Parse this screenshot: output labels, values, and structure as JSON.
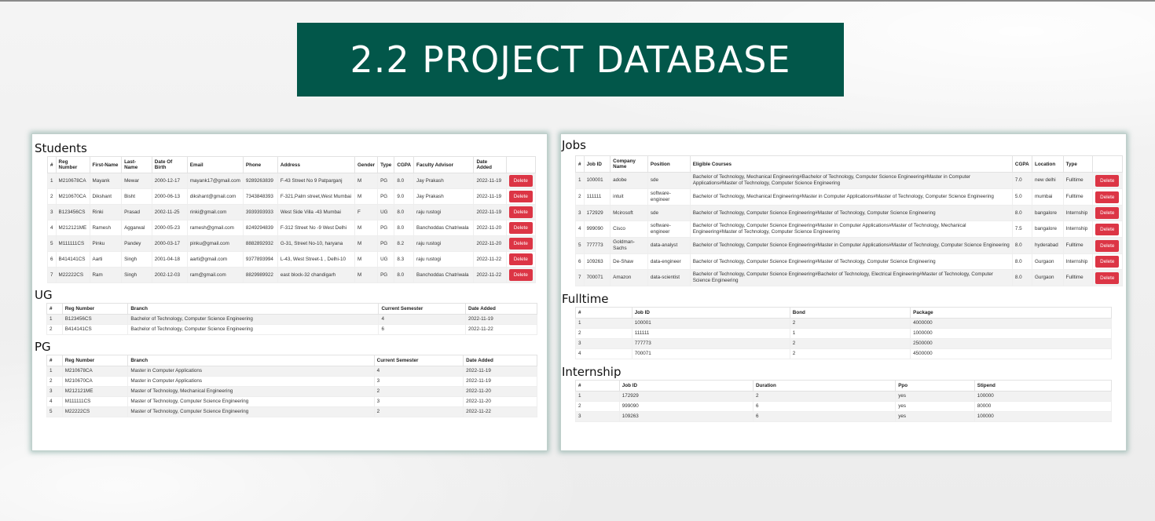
{
  "slide_title": "2.2  PROJECT DATABASE",
  "colors": {
    "title_bg": "#02574a",
    "delete_btn": "#dc3545"
  },
  "delete_label": "Delete",
  "students": {
    "title": "Students",
    "headers": [
      "#",
      "Reg Number",
      "First-Name",
      "Last-Name",
      "Date Of Birth",
      "Email",
      "Phone",
      "Address",
      "Gender",
      "Type",
      "CGPA",
      "Faculty Advisor",
      "Date Added",
      ""
    ],
    "rows": [
      [
        "1",
        "M210678CA",
        "Mayank",
        "Mewar",
        "2000-12-17",
        "mayank17@gmail.com",
        "9289263839",
        "F-43 Street No 9 Patparganj",
        "M",
        "PG",
        "8.0",
        "Jay Prakash",
        "2022-11-19"
      ],
      [
        "2",
        "M210670CA",
        "Dikshant",
        "Bisht",
        "2000-06-13",
        "dikshant@gmail.com",
        "7343848393",
        "F-321,Palm street,West Mumbai",
        "M",
        "PG",
        "9.0",
        "Jay Prakash",
        "2022-11-19"
      ],
      [
        "3",
        "B123456CS",
        "Rinki",
        "Prasad",
        "2002-11-25",
        "rinki@gmail.com",
        "3939393933",
        "West Side Villa -43 Mumbai",
        "F",
        "UG",
        "8.0",
        "raju rustogi",
        "2022-11-19"
      ],
      [
        "4",
        "M212121ME",
        "Ramesh",
        "Aggarwal",
        "2000-05-23",
        "ramesh@gmail.com",
        "8249294839",
        "F-312 Street No -9 West Delhi",
        "M",
        "PG",
        "8.0",
        "Banchoddas Chatriwala",
        "2022-11-20"
      ],
      [
        "5",
        "M111111CS",
        "Pinku",
        "Pandey",
        "2000-03-17",
        "pinku@gmail.com",
        "8882892932",
        "G-31, Street No-10, haryana",
        "M",
        "PG",
        "8.2",
        "raju rustogi",
        "2022-11-20"
      ],
      [
        "6",
        "B414141CS",
        "Aarti",
        "Singh",
        "2001-04-18",
        "aarti@gmail.com",
        "9377893994",
        "L-43, West Street-1 , Delhi-10",
        "M",
        "UG",
        "8.3",
        "raju rustogi",
        "2022-11-22"
      ],
      [
        "7",
        "M22222CS",
        "Ram",
        "Singh",
        "2002-12-03",
        "ram@gmail.com",
        "8829989922",
        "east block-32 chandigarh",
        "M",
        "PG",
        "8.0",
        "Banchoddas Chatriwala",
        "2022-11-22"
      ]
    ]
  },
  "ug": {
    "title": "UG",
    "headers": [
      "#",
      "Reg Number",
      "Branch",
      "Current Semester",
      "Date Added"
    ],
    "rows": [
      [
        "1",
        "B123456CS",
        "Bachelor of Technology, Computer Science Engineering",
        "4",
        "2022-11-19"
      ],
      [
        "2",
        "B414141CS",
        "Bachelor of Technology, Computer Science Engineering",
        "6",
        "2022-11-22"
      ]
    ]
  },
  "pg": {
    "title": "PG",
    "headers": [
      "#",
      "Reg Number",
      "Branch",
      "Current Semester",
      "Date Added"
    ],
    "rows": [
      [
        "1",
        "M210678CA",
        "Master in Computer Applications",
        "4",
        "2022-11-19"
      ],
      [
        "2",
        "M210670CA",
        "Master in Computer Applications",
        "3",
        "2022-11-19"
      ],
      [
        "3",
        "M212121ME",
        "Master of Technology, Mechanical Engineering",
        "2",
        "2022-11-20"
      ],
      [
        "4",
        "M111111CS",
        "Master of Technology, Computer Science Engineering",
        "3",
        "2022-11-20"
      ],
      [
        "5",
        "M22222CS",
        "Master of Technology, Computer Science Engineering",
        "2",
        "2022-11-22"
      ]
    ]
  },
  "jobs": {
    "title": "Jobs",
    "headers": [
      "#",
      "Job ID",
      "Company Name",
      "Position",
      "Eligible Courses",
      "CGPA",
      "Location",
      "Type",
      ""
    ],
    "rows": [
      [
        "1",
        "100001",
        "adobe",
        "sde",
        "Bachelor of Technology, Mechanical Engineering#Bachelor of Technology, Computer Science Engineering#Master in Computer Applications#Master of Technology, Computer Science Engineering",
        "7.0",
        "new delhi",
        "Fulltime"
      ],
      [
        "2",
        "111111",
        "intuit",
        "software-engineer",
        "Bachelor of Technology, Mechanical Engineering#Master in Computer Applications#Master of Technology, Computer Science Engineering",
        "5.0",
        "mumbai",
        "Fulltime"
      ],
      [
        "3",
        "172929",
        "Mcirosoft",
        "sde",
        "Bachelor of Technology, Computer Science Engineering#Master of Technology, Computer Science Engineering",
        "8.0",
        "bangalore",
        "Internship"
      ],
      [
        "4",
        "999090",
        "Cisco",
        "software-engineer",
        "Bachelor of Technology, Computer Science Engineering#Master in Computer Applications#Master of Technology, Mechanical Engineering#Master of Technology, Computer Science Engineering",
        "7.5",
        "bangalore",
        "Internship"
      ],
      [
        "5",
        "777773",
        "Goldman-Sachs",
        "data-analyst",
        "Bachelor of Technology, Computer Science Engineering#Master in Computer Applications#Master of Technology, Computer Science Engineering",
        "8.0",
        "hyderabad",
        "Fulltime"
      ],
      [
        "6",
        "109263",
        "De-Shaw",
        "data-engineer",
        "Bachelor of Technology, Computer Science Engineering#Master of Technology, Computer Science Engineering",
        "8.0",
        "Gurgaon",
        "Internship"
      ],
      [
        "7",
        "700071",
        "Amazon",
        "data-scientist",
        "Bachelor of Technology, Computer Science Engineering#Bachelor of Technology, Electrical Engineering#Master of Technology, Computer Science Engineering",
        "8.0",
        "Gurgaon",
        "Fulltime"
      ]
    ]
  },
  "fulltime": {
    "title": "Fulltime",
    "headers": [
      "#",
      "Job ID",
      "Bond",
      "Package"
    ],
    "rows": [
      [
        "1",
        "100001",
        "2",
        "4000000"
      ],
      [
        "2",
        "111111",
        "1",
        "1000000"
      ],
      [
        "3",
        "777773",
        "2",
        "2500000"
      ],
      [
        "4",
        "700071",
        "2",
        "4500000"
      ]
    ]
  },
  "internship": {
    "title": "Internship",
    "headers": [
      "#",
      "Job ID",
      "Duration",
      "Ppo",
      "Stipend"
    ],
    "rows": [
      [
        "1",
        "172929",
        "2",
        "yes",
        "100000"
      ],
      [
        "2",
        "999090",
        "6",
        "yes",
        "80000"
      ],
      [
        "3",
        "109263",
        "6",
        "yes",
        "100000"
      ]
    ]
  }
}
